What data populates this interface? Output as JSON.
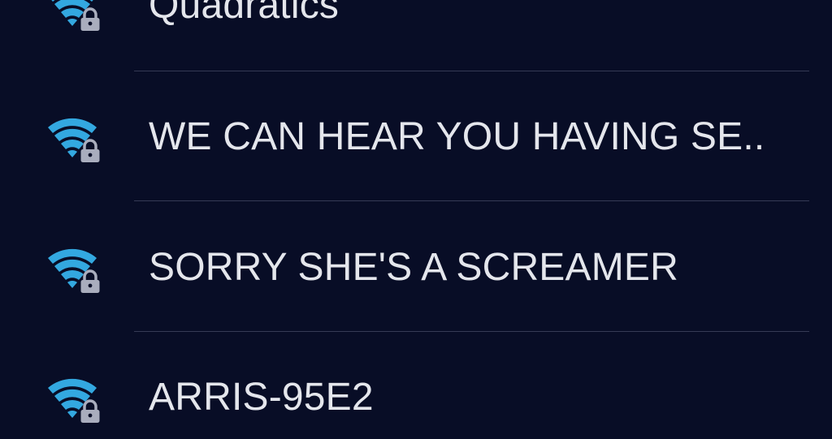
{
  "colors": {
    "background": "#080d26",
    "label": "#e4e6ec",
    "divider": "#353a55",
    "wifi_signal": "#33a8e0",
    "lock": "#a9adbd"
  },
  "networks": [
    {
      "name": "Quadratics",
      "icon": "wifi-secured-icon"
    },
    {
      "name": "WE CAN HEAR YOU HAVING SE..",
      "icon": "wifi-secured-icon"
    },
    {
      "name": "SORRY SHE'S A SCREAMER",
      "icon": "wifi-secured-icon"
    },
    {
      "name": "ARRIS-95E2",
      "icon": "wifi-secured-icon"
    }
  ]
}
